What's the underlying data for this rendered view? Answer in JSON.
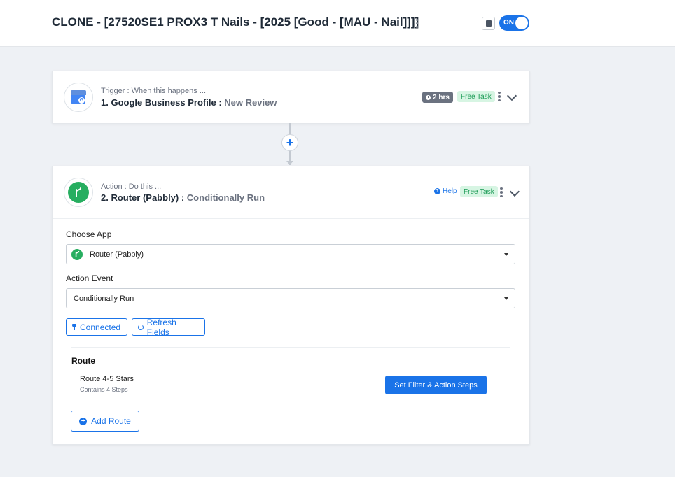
{
  "workflow": {
    "title": "CLONE - [27520SE1 PROX3 T Nails - [2025 [Good - [MAU - Nail]]]]",
    "toggle_label": "ON"
  },
  "trigger": {
    "subtitle": "Trigger : When this happens ...",
    "title": "1. Google Business Profile : ",
    "event": "New Review",
    "app_icon": "google-business-profile-icon",
    "time_badge": "2 hrs",
    "task_badge": "Free Task"
  },
  "connector": {
    "add_symbol": "+"
  },
  "action": {
    "subtitle": "Action : Do this ...",
    "title": "2. Router (Pabbly) : ",
    "event": "Conditionally Run",
    "app_icon": "router-icon",
    "help_label": "Help",
    "task_badge": "Free Task",
    "choose_app_label": "Choose App",
    "choose_app_value": "Router (Pabbly)",
    "action_event_label": "Action Event",
    "action_event_value": "Conditionally Run",
    "connected_label": "Connected",
    "refresh_label": "Refresh Fields",
    "route_heading": "Route",
    "routes": [
      {
        "name": "Route 4-5 Stars",
        "steps": "Contains 4 Steps",
        "button": "Set Filter & Action Steps"
      }
    ],
    "add_route_label": "Add Route"
  },
  "colors": {
    "accent": "#1a73e8",
    "router_green": "#27ae60",
    "free_badge_bg": "#d7f5e3",
    "free_badge_text": "#1b9a55",
    "time_badge_bg": "#6b7280"
  }
}
